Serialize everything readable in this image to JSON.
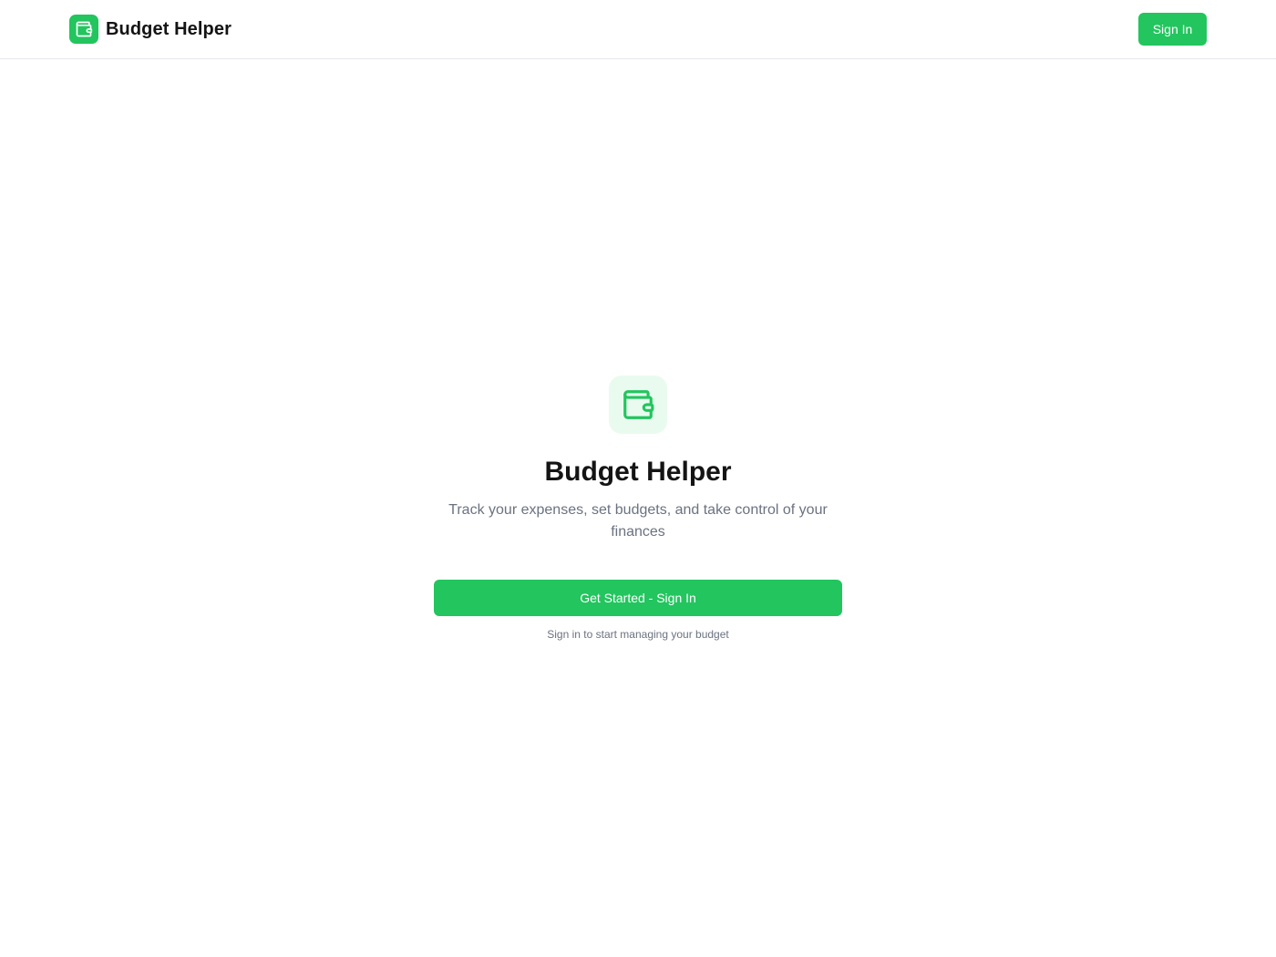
{
  "header": {
    "brand_name": "Budget Helper",
    "brand_icon": "wallet-icon",
    "signin_label": "Sign In"
  },
  "hero": {
    "icon": "wallet-icon",
    "title": "Budget Helper",
    "subtitle": "Track your expenses, set budgets, and take control of your finances",
    "cta_label": "Get Started - Sign In",
    "cta_hint": "Sign in to start managing your budget"
  },
  "colors": {
    "accent": "#22c55e",
    "accent_light": "#e9fbef",
    "muted_text": "#6b7280",
    "heading_text": "#141414",
    "border": "#e5e7eb"
  }
}
